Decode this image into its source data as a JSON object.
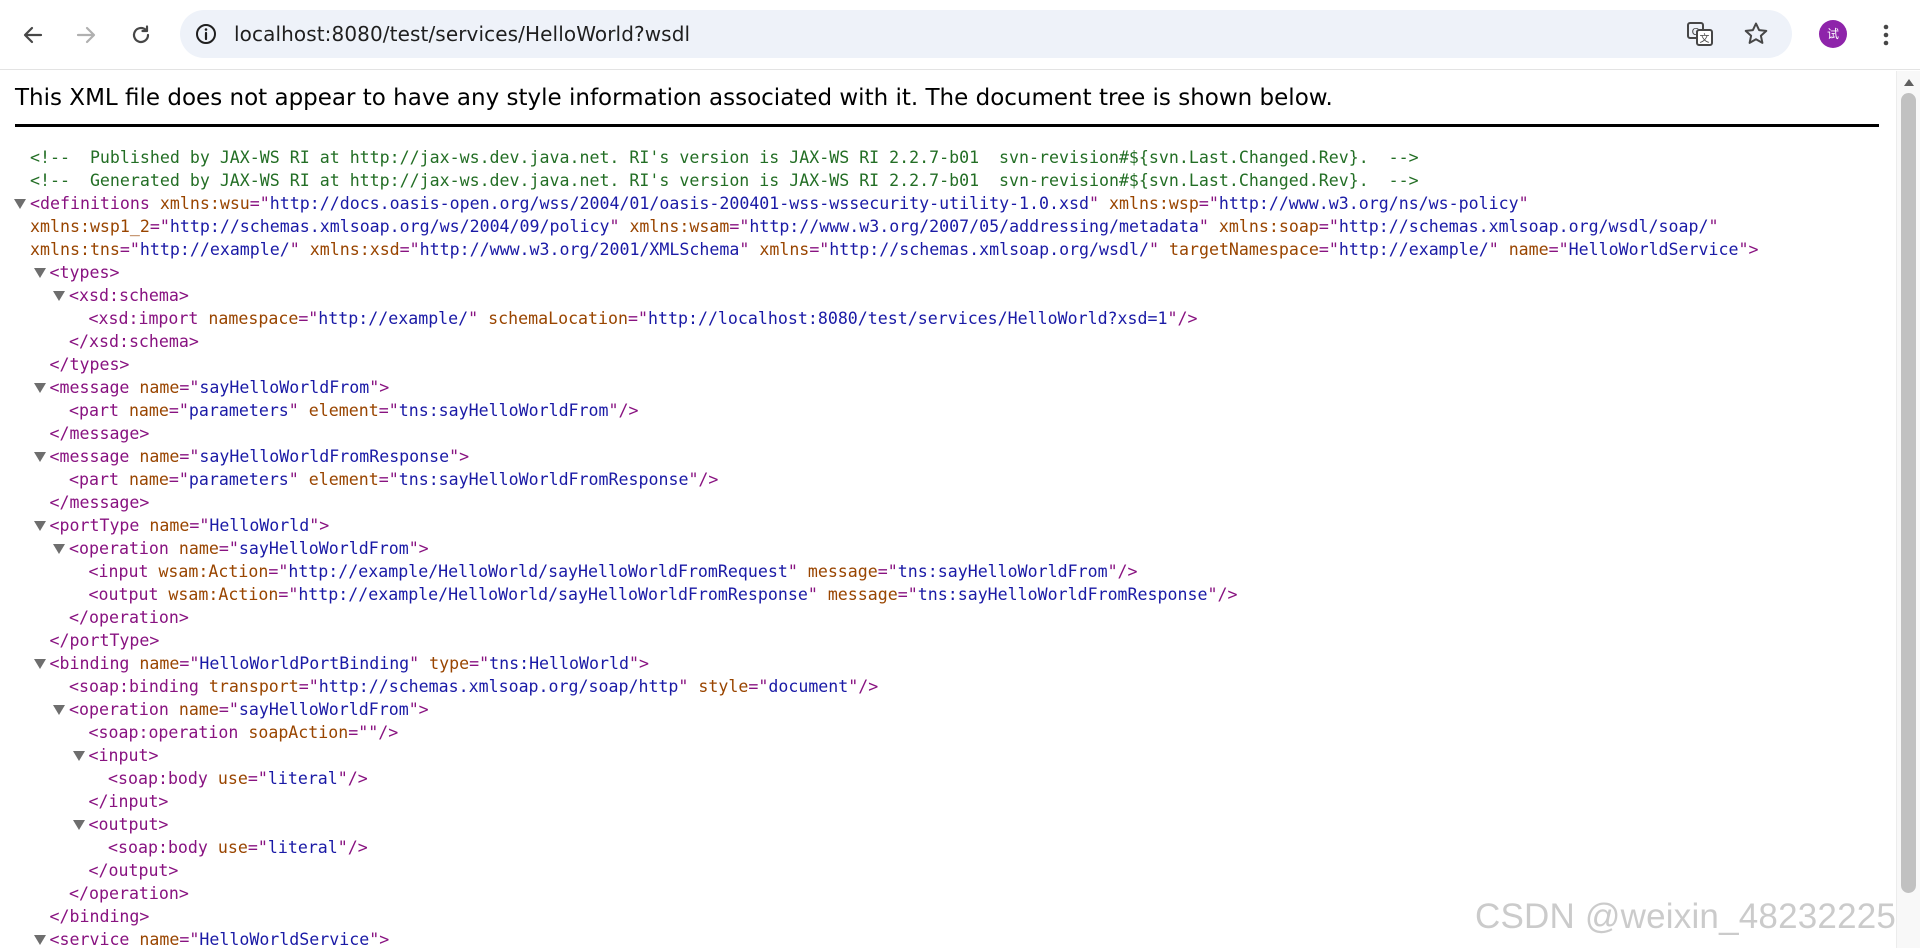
{
  "browser": {
    "url": "localhost:8080/test/services/HelloWorld?wsdl",
    "avatar_initial": "试"
  },
  "page": {
    "banner": "This XML file does not appear to have any style information associated with it. The document tree is shown below."
  },
  "colors": {
    "tag": "#881280",
    "attr_name": "#994500",
    "attr_value": "#1a1aa6",
    "comment": "#236e25",
    "avatar": "#8e24aa"
  },
  "xml_lines": [
    {
      "indent": 0,
      "toggle": false,
      "parts": [
        [
          "cm",
          "<!--  Published by JAX-WS RI at http://jax-ws.dev.java.net. RI's version is JAX-WS RI 2.2.7-b01  svn-revision#${svn.Last.Changed.Rev}.  -->"
        ]
      ]
    },
    {
      "indent": 0,
      "toggle": false,
      "parts": [
        [
          "cm",
          "<!--  Generated by JAX-WS RI at http://jax-ws.dev.java.net. RI's version is JAX-WS RI 2.2.7-b01  svn-revision#${svn.Last.Changed.Rev}.  -->"
        ]
      ]
    },
    {
      "indent": 0,
      "toggle": true,
      "parts": [
        [
          "tg",
          "<definitions"
        ],
        [
          "an",
          " xmlns:wsu"
        ],
        [
          "tg",
          "=\""
        ],
        [
          "av",
          "http://docs.oasis-open.org/wss/2004/01/oasis-200401-wss-wssecurity-utility-1.0.xsd"
        ],
        [
          "tg",
          "\""
        ],
        [
          "an",
          " xmlns:wsp"
        ],
        [
          "tg",
          "=\""
        ],
        [
          "av",
          "http://www.w3.org/ns/ws-policy"
        ],
        [
          "tg",
          "\""
        ]
      ]
    },
    {
      "indent": 0,
      "toggle": false,
      "parts": [
        [
          "an",
          "xmlns:wsp1_2"
        ],
        [
          "tg",
          "=\""
        ],
        [
          "av",
          "http://schemas.xmlsoap.org/ws/2004/09/policy"
        ],
        [
          "tg",
          "\""
        ],
        [
          "an",
          " xmlns:wsam"
        ],
        [
          "tg",
          "=\""
        ],
        [
          "av",
          "http://www.w3.org/2007/05/addressing/metadata"
        ],
        [
          "tg",
          "\""
        ],
        [
          "an",
          " xmlns:soap"
        ],
        [
          "tg",
          "=\""
        ],
        [
          "av",
          "http://schemas.xmlsoap.org/wsdl/soap/"
        ],
        [
          "tg",
          "\""
        ]
      ]
    },
    {
      "indent": 0,
      "toggle": false,
      "parts": [
        [
          "an",
          "xmlns:tns"
        ],
        [
          "tg",
          "=\""
        ],
        [
          "av",
          "http://example/"
        ],
        [
          "tg",
          "\""
        ],
        [
          "an",
          " xmlns:xsd"
        ],
        [
          "tg",
          "=\""
        ],
        [
          "av",
          "http://www.w3.org/2001/XMLSchema"
        ],
        [
          "tg",
          "\""
        ],
        [
          "an",
          " xmlns"
        ],
        [
          "tg",
          "=\""
        ],
        [
          "av",
          "http://schemas.xmlsoap.org/wsdl/"
        ],
        [
          "tg",
          "\""
        ],
        [
          "an",
          " targetNamespace"
        ],
        [
          "tg",
          "=\""
        ],
        [
          "av",
          "http://example/"
        ],
        [
          "tg",
          "\""
        ],
        [
          "an",
          " name"
        ],
        [
          "tg",
          "=\""
        ],
        [
          "av",
          "HelloWorldService"
        ],
        [
          "tg",
          "\">"
        ]
      ]
    },
    {
      "indent": 1,
      "toggle": true,
      "parts": [
        [
          "tg",
          "<types>"
        ]
      ]
    },
    {
      "indent": 2,
      "toggle": true,
      "parts": [
        [
          "tg",
          "<xsd:schema>"
        ]
      ]
    },
    {
      "indent": 3,
      "toggle": false,
      "parts": [
        [
          "tg",
          "<xsd:import"
        ],
        [
          "an",
          " namespace"
        ],
        [
          "tg",
          "=\""
        ],
        [
          "av",
          "http://example/"
        ],
        [
          "tg",
          "\""
        ],
        [
          "an",
          " schemaLocation"
        ],
        [
          "tg",
          "=\""
        ],
        [
          "av",
          "http://localhost:8080/test/services/HelloWorld?xsd=1"
        ],
        [
          "tg",
          "\"/>"
        ]
      ]
    },
    {
      "indent": 2,
      "toggle": false,
      "parts": [
        [
          "tg",
          "</xsd:schema>"
        ]
      ]
    },
    {
      "indent": 1,
      "toggle": false,
      "parts": [
        [
          "tg",
          "</types>"
        ]
      ]
    },
    {
      "indent": 1,
      "toggle": true,
      "parts": [
        [
          "tg",
          "<message"
        ],
        [
          "an",
          " name"
        ],
        [
          "tg",
          "=\""
        ],
        [
          "av",
          "sayHelloWorldFrom"
        ],
        [
          "tg",
          "\">"
        ]
      ]
    },
    {
      "indent": 2,
      "toggle": false,
      "parts": [
        [
          "tg",
          "<part"
        ],
        [
          "an",
          " name"
        ],
        [
          "tg",
          "=\""
        ],
        [
          "av",
          "parameters"
        ],
        [
          "tg",
          "\""
        ],
        [
          "an",
          " element"
        ],
        [
          "tg",
          "=\""
        ],
        [
          "av",
          "tns:sayHelloWorldFrom"
        ],
        [
          "tg",
          "\"/>"
        ]
      ]
    },
    {
      "indent": 1,
      "toggle": false,
      "parts": [
        [
          "tg",
          "</message>"
        ]
      ]
    },
    {
      "indent": 1,
      "toggle": true,
      "parts": [
        [
          "tg",
          "<message"
        ],
        [
          "an",
          " name"
        ],
        [
          "tg",
          "=\""
        ],
        [
          "av",
          "sayHelloWorldFromResponse"
        ],
        [
          "tg",
          "\">"
        ]
      ]
    },
    {
      "indent": 2,
      "toggle": false,
      "parts": [
        [
          "tg",
          "<part"
        ],
        [
          "an",
          " name"
        ],
        [
          "tg",
          "=\""
        ],
        [
          "av",
          "parameters"
        ],
        [
          "tg",
          "\""
        ],
        [
          "an",
          " element"
        ],
        [
          "tg",
          "=\""
        ],
        [
          "av",
          "tns:sayHelloWorldFromResponse"
        ],
        [
          "tg",
          "\"/>"
        ]
      ]
    },
    {
      "indent": 1,
      "toggle": false,
      "parts": [
        [
          "tg",
          "</message>"
        ]
      ]
    },
    {
      "indent": 1,
      "toggle": true,
      "parts": [
        [
          "tg",
          "<portType"
        ],
        [
          "an",
          " name"
        ],
        [
          "tg",
          "=\""
        ],
        [
          "av",
          "HelloWorld"
        ],
        [
          "tg",
          "\">"
        ]
      ]
    },
    {
      "indent": 2,
      "toggle": true,
      "parts": [
        [
          "tg",
          "<operation"
        ],
        [
          "an",
          " name"
        ],
        [
          "tg",
          "=\""
        ],
        [
          "av",
          "sayHelloWorldFrom"
        ],
        [
          "tg",
          "\">"
        ]
      ]
    },
    {
      "indent": 3,
      "toggle": false,
      "parts": [
        [
          "tg",
          "<input"
        ],
        [
          "an",
          " wsam:Action"
        ],
        [
          "tg",
          "=\""
        ],
        [
          "av",
          "http://example/HelloWorld/sayHelloWorldFromRequest"
        ],
        [
          "tg",
          "\""
        ],
        [
          "an",
          " message"
        ],
        [
          "tg",
          "=\""
        ],
        [
          "av",
          "tns:sayHelloWorldFrom"
        ],
        [
          "tg",
          "\"/>"
        ]
      ]
    },
    {
      "indent": 3,
      "toggle": false,
      "parts": [
        [
          "tg",
          "<output"
        ],
        [
          "an",
          " wsam:Action"
        ],
        [
          "tg",
          "=\""
        ],
        [
          "av",
          "http://example/HelloWorld/sayHelloWorldFromResponse"
        ],
        [
          "tg",
          "\""
        ],
        [
          "an",
          " message"
        ],
        [
          "tg",
          "=\""
        ],
        [
          "av",
          "tns:sayHelloWorldFromResponse"
        ],
        [
          "tg",
          "\"/>"
        ]
      ]
    },
    {
      "indent": 2,
      "toggle": false,
      "parts": [
        [
          "tg",
          "</operation>"
        ]
      ]
    },
    {
      "indent": 1,
      "toggle": false,
      "parts": [
        [
          "tg",
          "</portType>"
        ]
      ]
    },
    {
      "indent": 1,
      "toggle": true,
      "parts": [
        [
          "tg",
          "<binding"
        ],
        [
          "an",
          " name"
        ],
        [
          "tg",
          "=\""
        ],
        [
          "av",
          "HelloWorldPortBinding"
        ],
        [
          "tg",
          "\""
        ],
        [
          "an",
          " type"
        ],
        [
          "tg",
          "=\""
        ],
        [
          "av",
          "tns:HelloWorld"
        ],
        [
          "tg",
          "\">"
        ]
      ]
    },
    {
      "indent": 2,
      "toggle": false,
      "parts": [
        [
          "tg",
          "<soap:binding"
        ],
        [
          "an",
          " transport"
        ],
        [
          "tg",
          "=\""
        ],
        [
          "av",
          "http://schemas.xmlsoap.org/soap/http"
        ],
        [
          "tg",
          "\""
        ],
        [
          "an",
          " style"
        ],
        [
          "tg",
          "=\""
        ],
        [
          "av",
          "document"
        ],
        [
          "tg",
          "\"/>"
        ]
      ]
    },
    {
      "indent": 2,
      "toggle": true,
      "parts": [
        [
          "tg",
          "<operation"
        ],
        [
          "an",
          " name"
        ],
        [
          "tg",
          "=\""
        ],
        [
          "av",
          "sayHelloWorldFrom"
        ],
        [
          "tg",
          "\">"
        ]
      ]
    },
    {
      "indent": 3,
      "toggle": false,
      "parts": [
        [
          "tg",
          "<soap:operation"
        ],
        [
          "an",
          " soapAction"
        ],
        [
          "tg",
          "=\"\"/>"
        ]
      ]
    },
    {
      "indent": 3,
      "toggle": true,
      "parts": [
        [
          "tg",
          "<input>"
        ]
      ]
    },
    {
      "indent": 4,
      "toggle": false,
      "parts": [
        [
          "tg",
          "<soap:body"
        ],
        [
          "an",
          " use"
        ],
        [
          "tg",
          "=\""
        ],
        [
          "av",
          "literal"
        ],
        [
          "tg",
          "\"/>"
        ]
      ]
    },
    {
      "indent": 3,
      "toggle": false,
      "parts": [
        [
          "tg",
          "</input>"
        ]
      ]
    },
    {
      "indent": 3,
      "toggle": true,
      "parts": [
        [
          "tg",
          "<output>"
        ]
      ]
    },
    {
      "indent": 4,
      "toggle": false,
      "parts": [
        [
          "tg",
          "<soap:body"
        ],
        [
          "an",
          " use"
        ],
        [
          "tg",
          "=\""
        ],
        [
          "av",
          "literal"
        ],
        [
          "tg",
          "\"/>"
        ]
      ]
    },
    {
      "indent": 3,
      "toggle": false,
      "parts": [
        [
          "tg",
          "</output>"
        ]
      ]
    },
    {
      "indent": 2,
      "toggle": false,
      "parts": [
        [
          "tg",
          "</operation>"
        ]
      ]
    },
    {
      "indent": 1,
      "toggle": false,
      "parts": [
        [
          "tg",
          "</binding>"
        ]
      ]
    },
    {
      "indent": 1,
      "toggle": true,
      "parts": [
        [
          "tg",
          "<service"
        ],
        [
          "an",
          " name"
        ],
        [
          "tg",
          "=\""
        ],
        [
          "av",
          "HelloWorldService"
        ],
        [
          "tg",
          "\">"
        ]
      ]
    }
  ],
  "watermark": "CSDN @weixin_48232225"
}
